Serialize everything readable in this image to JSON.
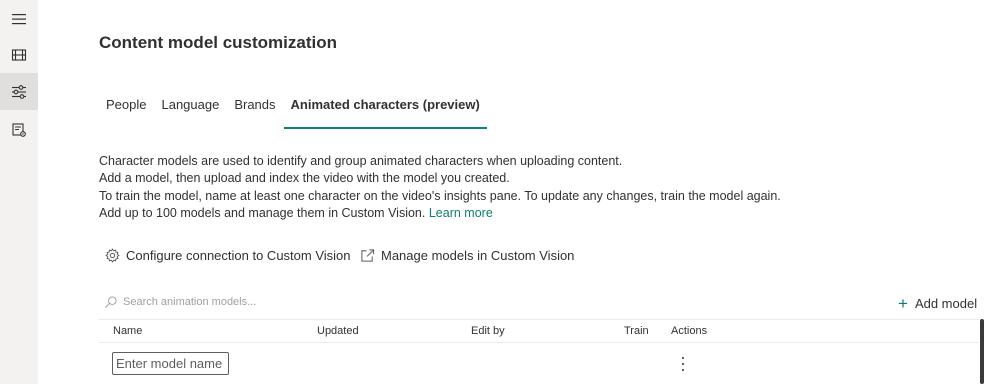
{
  "rail": {
    "items": [
      {
        "icon": "hamburger-menu-icon"
      },
      {
        "icon": "film-icon"
      },
      {
        "icon": "sliders-icon",
        "active": true
      },
      {
        "icon": "settings-document-icon"
      }
    ]
  },
  "page": {
    "title": "Content model customization"
  },
  "tabs": [
    {
      "label": "People",
      "selected": false
    },
    {
      "label": "Language",
      "selected": false
    },
    {
      "label": "Brands",
      "selected": false
    },
    {
      "label": "Animated characters (preview)",
      "selected": true
    }
  ],
  "description": {
    "line1": "Character models are used to identify and group animated characters when uploading content.",
    "line2": "Add a model, then upload and index the video with the model you created.",
    "line3": "To train the model, name at least one character on the video's insights pane. To update any changes, train the model again.",
    "line4": "Add up to 100 models and manage them in Custom Vision.",
    "learn_more": "Learn more"
  },
  "commands": {
    "configure": {
      "label": "Configure connection to Custom Vision",
      "icon": "gear-icon"
    },
    "manage": {
      "label": "Manage models in Custom Vision",
      "icon": "open-external-icon"
    }
  },
  "search": {
    "placeholder": "Search animation models...",
    "value": ""
  },
  "add_model": {
    "label": "Add model"
  },
  "table": {
    "columns": [
      "Name",
      "Updated",
      "Edit by",
      "Train",
      "Actions"
    ],
    "rows": [
      {
        "name_placeholder": "Enter model name",
        "name_value": ""
      }
    ]
  },
  "colors": {
    "accent": "#168072",
    "link": "#0f7b6c",
    "rail_bg": "#f3f2f1",
    "rail_active": "#e1dfdd"
  }
}
